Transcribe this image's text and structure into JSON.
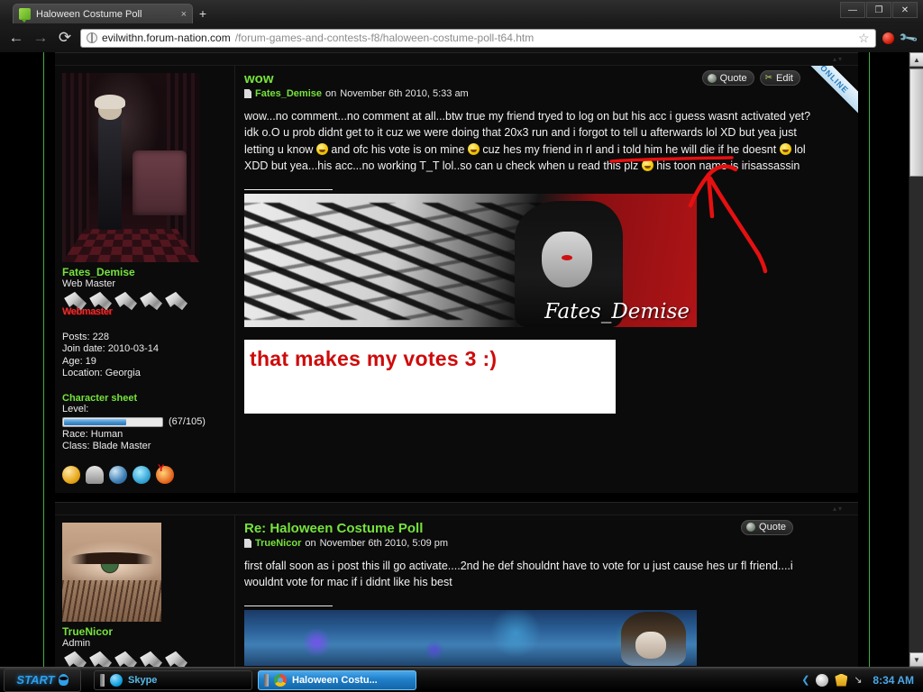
{
  "browser": {
    "tab_title": "Haloween Costume Poll",
    "tab_close": "×",
    "newtab_label": "+",
    "back_icon": "←",
    "forward_icon": "→",
    "reload_icon": "⟳",
    "url_domain": "evilwithn.forum-nation.com",
    "url_path": "/forum-games-and-contests-f8/haloween-costume-poll-t64.htm",
    "star_icon": "☆",
    "window_minimize": "—",
    "window_restore": "❐",
    "window_close": "✕"
  },
  "scrollbar": {
    "up_arrow": "▲",
    "down_arrow": "▼"
  },
  "posts": [
    {
      "subject": "wow",
      "author": "Fates_Demise",
      "meta_on": "on",
      "date": "November 6th 2010, 5:33 am",
      "rank": "Web Master",
      "rank_label": "Webmaster",
      "online_badge": "ONLINE",
      "actions": [
        {
          "label": "Quote",
          "icon": "quote-icon"
        },
        {
          "label": "Edit",
          "icon": "edit-icon"
        }
      ],
      "stats": [
        "Posts: 228",
        "Join date: 2010-03-14",
        "Age: 19",
        "Location: Georgia"
      ],
      "character_sheet": {
        "title": "Character sheet",
        "level_label": "Level:",
        "level_value": "(67/105)",
        "level_percent": 64,
        "race": "Race: Human",
        "class": "Class: Blade Master"
      },
      "contact_icons": [
        "email-icon",
        "pm-icon",
        "website-icon",
        "msn-icon",
        "yahoo-icon"
      ],
      "body_paragraphs": [
        "wow...no comment...no comment at all...btw true my friend tryed to log on but his acc i guess wasnt activated yet? idk o.O u prob didnt get to it cuz we were doing that 20x3 run and i forgot to tell u afterwards lol XD but yea just letting u know",
        "and ofc his vote is on mine",
        "cuz hes my friend in rl and i told him he will die if he doesnt",
        "lol XDD but yea...his acc...no working T_T lol..so can u check when u read this plz",
        "his toon name is irisassassin"
      ],
      "signature_name": "Fates_Demise",
      "annotation_caption": "that makes my votes 3 :)"
    },
    {
      "subject": "Re: Haloween Costume Poll",
      "author": "TrueNicor",
      "meta_on": "on",
      "date": "November 6th 2010, 5:09 pm",
      "rank": "Admin",
      "actions": [
        {
          "label": "Quote",
          "icon": "quote-icon"
        }
      ],
      "body_paragraphs": [
        "first ofall soon as i post this ill go activate....2nd he def shouldnt have to vote for u just cause hes ur fl friend....i wouldnt vote for mac if i didnt like his best"
      ]
    }
  ],
  "taskbar": {
    "start_label": "START",
    "items": [
      {
        "label": "Skype",
        "icon": "skype-icon",
        "active": false
      },
      {
        "label": "Haloween Costu...",
        "icon": "chrome-icon",
        "active": true
      }
    ],
    "tray_chevron": "❮",
    "tray_icons": [
      "msn-icon",
      "security-shield-icon",
      "minimize-arrow-icon"
    ],
    "clock": "8:34 AM"
  },
  "colors": {
    "accent_green": "#76e23c",
    "annotation_red": "#e51010",
    "link_blue": "#4aa8e8"
  }
}
